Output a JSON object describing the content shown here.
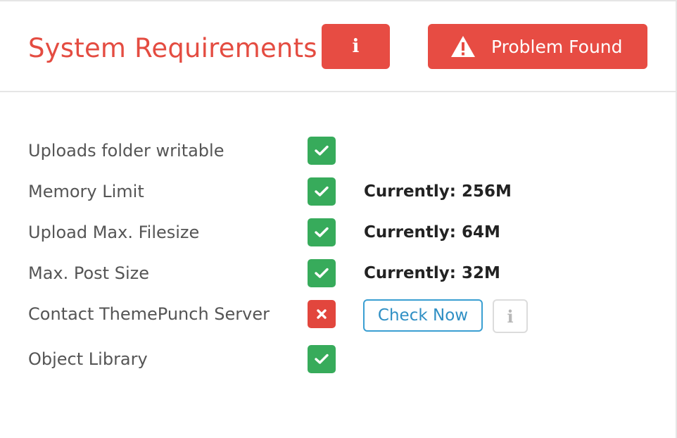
{
  "header": {
    "title": "System Requirements",
    "info_button_label": "i",
    "problem_button_label": "Problem Found",
    "problem_icon": "warning-triangle-icon"
  },
  "requirements": [
    {
      "label": "Uploads folder writable",
      "status": "ok",
      "status_icon": "check-icon",
      "value": ""
    },
    {
      "label": "Memory Limit",
      "status": "ok",
      "status_icon": "check-icon",
      "value": "Currently: 256M"
    },
    {
      "label": "Upload Max. Filesize",
      "status": "ok",
      "status_icon": "check-icon",
      "value": "Currently: 64M"
    },
    {
      "label": "Max. Post Size",
      "status": "ok",
      "status_icon": "check-icon",
      "value": "Currently: 32M"
    },
    {
      "label": "Contact ThemePunch Server",
      "status": "fail",
      "status_icon": "x-icon",
      "action_label": "Check Now",
      "info_label": "i"
    },
    {
      "label": "Object Library",
      "status": "ok",
      "status_icon": "check-icon",
      "value": ""
    }
  ],
  "colors": {
    "accent_red": "#e74c43",
    "success_green": "#37ab5b",
    "link_blue": "#3a9fd2"
  }
}
